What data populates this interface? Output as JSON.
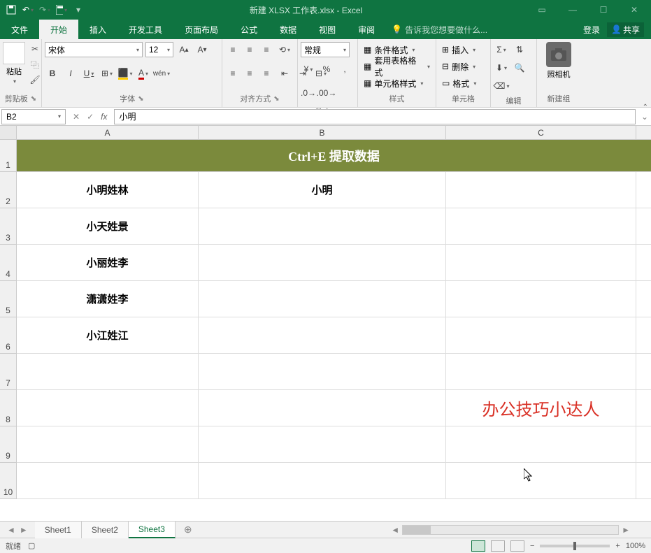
{
  "title": "新建 XLSX 工作表.xlsx - Excel",
  "menu": {
    "file": "文件",
    "home": "开始",
    "insert": "插入",
    "dev": "开发工具",
    "layout": "页面布局",
    "formula": "公式",
    "data": "数据",
    "view": "视图",
    "review": "审阅",
    "tell_me": "告诉我您想要做什么...",
    "login": "登录",
    "share": "共享"
  },
  "ribbon": {
    "clipboard": {
      "label": "剪贴板",
      "paste": "粘贴"
    },
    "font": {
      "label": "字体",
      "name": "宋体",
      "size": "12"
    },
    "align": {
      "label": "对齐方式"
    },
    "number": {
      "label": "数字",
      "format": "常规"
    },
    "styles": {
      "label": "样式",
      "cond": "条件格式",
      "table": "套用表格格式",
      "cell": "单元格样式"
    },
    "cells": {
      "label": "单元格",
      "insert": "插入",
      "delete": "删除",
      "format": "格式"
    },
    "edit": {
      "label": "编辑"
    },
    "new": {
      "label": "新建组",
      "camera": "照相机"
    }
  },
  "name_box": "B2",
  "formula": "小明",
  "columns": [
    "A",
    "B",
    "C"
  ],
  "rows": [
    "1",
    "2",
    "3",
    "4",
    "5",
    "6",
    "7",
    "8",
    "9",
    "10"
  ],
  "merged_title": "Ctrl+E   提取数据",
  "data_rows": [
    {
      "A": "小明姓林",
      "B": "小明",
      "C": ""
    },
    {
      "A": "小天姓景",
      "B": "",
      "C": ""
    },
    {
      "A": "小丽姓李",
      "B": "",
      "C": ""
    },
    {
      "A": "潇潇姓李",
      "B": "",
      "C": ""
    },
    {
      "A": "小江姓江",
      "B": "",
      "C": ""
    },
    {
      "A": "",
      "B": "",
      "C": ""
    },
    {
      "A": "",
      "B": "",
      "C": "办公技巧小达人"
    },
    {
      "A": "",
      "B": "",
      "C": ""
    },
    {
      "A": "",
      "B": "",
      "C": ""
    }
  ],
  "sheets": [
    "Sheet1",
    "Sheet2",
    "Sheet3"
  ],
  "active_sheet": 2,
  "status": {
    "ready": "就绪",
    "zoom": "100%"
  }
}
